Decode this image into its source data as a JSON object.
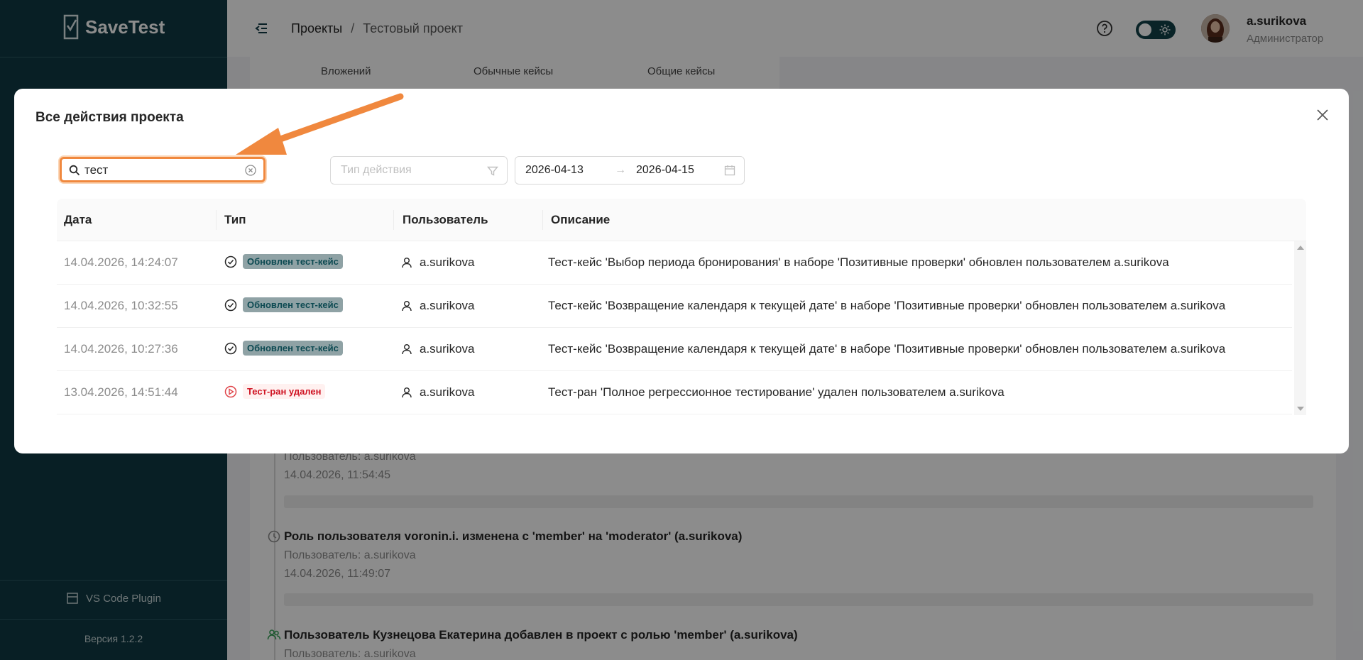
{
  "sidebar": {
    "logo_text": "SaveTest",
    "plugin_label": "VS Code Plugin",
    "version_label": "Версия 1.2.2"
  },
  "header": {
    "breadcrumb_root": "Проекты",
    "breadcrumb_sep": "/",
    "breadcrumb_current": "Тестовый проект",
    "user_name": "a.surikova",
    "user_role": "Администратор"
  },
  "background": {
    "tabs": [
      "Вложений",
      "Обычные кейсы",
      "Общие кейсы"
    ],
    "feed": [
      {
        "title": "",
        "meta": "Пользователь: a.surikova",
        "date": "14.04.2026, 11:54:45"
      },
      {
        "title": "Роль пользователя voronin.i. изменена с 'member' на 'moderator' (a.surikova)",
        "meta": "Пользователь: a.surikova",
        "date": "14.04.2026, 11:49:07"
      },
      {
        "title": "Пользователь Кузнецова Екатерина добавлен в проект с ролью 'member' (a.surikova)",
        "meta": "Пользователь: a.surikova",
        "date": ""
      }
    ]
  },
  "modal": {
    "title": "Все действия проекта",
    "search": {
      "value": "тест"
    },
    "type_filter": {
      "placeholder": "Тип действия"
    },
    "date_from": "2026-04-13",
    "date_arrow": "→",
    "date_to": "2026-04-15",
    "columns": {
      "date": "Дата",
      "type": "Тип",
      "user": "Пользователь",
      "description": "Описание"
    },
    "rows": [
      {
        "date": "14.04.2026, 14:24:07",
        "type": "Обновлен тест-кейс",
        "user": "a.surikova",
        "description": "Тест-кейс 'Выбор периода бронирования' в наборе 'Позитивные проверки' обновлен пользователем a.surikova"
      },
      {
        "date": "14.04.2026, 10:32:55",
        "type": "Обновлен тест-кейс",
        "user": "a.surikova",
        "description": "Тест-кейс 'Возвращение календаря к текущей дате' в наборе 'Позитивные проверки' обновлен пользователем a.surikova"
      },
      {
        "date": "14.04.2026, 10:27:36",
        "type": "Обновлен тест-кейс",
        "user": "a.surikova",
        "description": "Тест-кейс 'Возвращение календаря к текущей дате' в наборе 'Позитивные проверки' обновлен пользователем a.surikova"
      },
      {
        "date": "13.04.2026, 14:51:44",
        "type": "Тест-ран удален",
        "user": "a.surikova",
        "description": "Тест-ран 'Полное регрессионное тестирование' удален пользователем a.surikova"
      }
    ]
  },
  "colors": {
    "sidebar_bg": "#0f3a44",
    "accent_orange": "#f0883e",
    "tag_updated_bg": "#8fa2a5",
    "tag_deleted_text": "#cf1322"
  }
}
